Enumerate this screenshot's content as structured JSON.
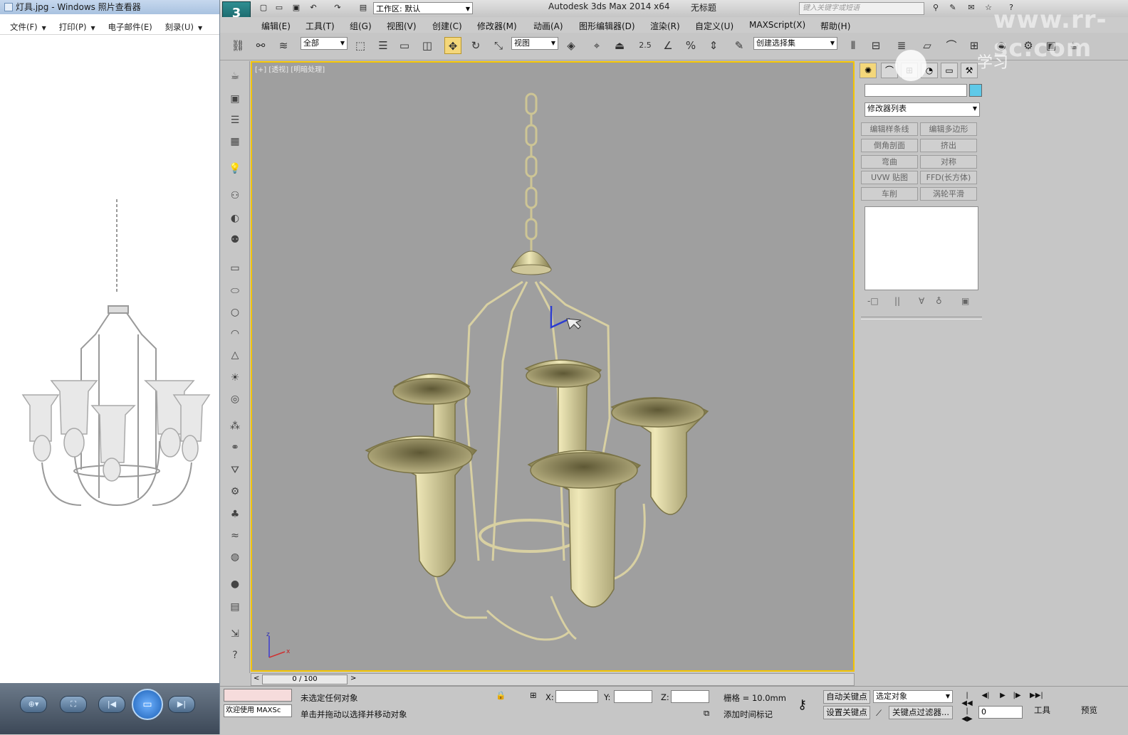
{
  "photo_viewer": {
    "title": "灯具.jpg - Windows 照片查看器",
    "menu": [
      {
        "label": "文件(F)"
      },
      {
        "label": "打印(P)"
      },
      {
        "label": "电子邮件(E)"
      },
      {
        "label": "刻录(U)"
      }
    ]
  },
  "max": {
    "workspace": "工作区: 默认",
    "app_title": "Autodesk 3ds Max  2014 x64",
    "file_title": "无标题",
    "search_placeholder": "键入关键字或短语",
    "menu": [
      "编辑(E)",
      "工具(T)",
      "组(G)",
      "视图(V)",
      "创建(C)",
      "修改器(M)",
      "动画(A)",
      "图形编辑器(D)",
      "渲染(R)",
      "自定义(U)",
      "MAXScript(X)",
      "帮助(H)"
    ],
    "toolbar": {
      "filter": "全部",
      "ref_coord": "视图",
      "snap_value": "2.5",
      "selection_set": "创建选择集"
    },
    "viewport_label": "[+] [透视] [明暗处理]",
    "timeline": {
      "position": "0 / 100",
      "prev": "<",
      "next": ">"
    },
    "command_panel": {
      "modifier_list": "修改器列表",
      "buttons": [
        "编辑样条线",
        "编辑多边形",
        "倒角剖面",
        "挤出",
        "弯曲",
        "对称",
        "UVW 贴图",
        "FFD(长方体)",
        "车削",
        "涡轮平滑"
      ],
      "stack_icons": [
        "-□",
        "||",
        "∀",
        "♁",
        "▣"
      ]
    },
    "status": {
      "welcome": "欢迎使用 MAXSc",
      "selection": "未选定任何对象",
      "prompt": "单击并拖动以选择并移动对象",
      "x_label": "X:",
      "y_label": "Y:",
      "z_label": "Z:",
      "grid": "栅格 = 10.0mm",
      "add_time_tag": "添加时间标记",
      "auto_key": "自动关键点",
      "set_key": "设置关键点",
      "key_filter_target": "选定对象",
      "key_filters": "关键点过滤器...",
      "frame": "0",
      "tools": "工具",
      "preview": "预览"
    },
    "axis": {
      "x": "x",
      "z": "z"
    }
  },
  "watermark": {
    "site": "www.rr-sc.com",
    "brand": "学习"
  }
}
